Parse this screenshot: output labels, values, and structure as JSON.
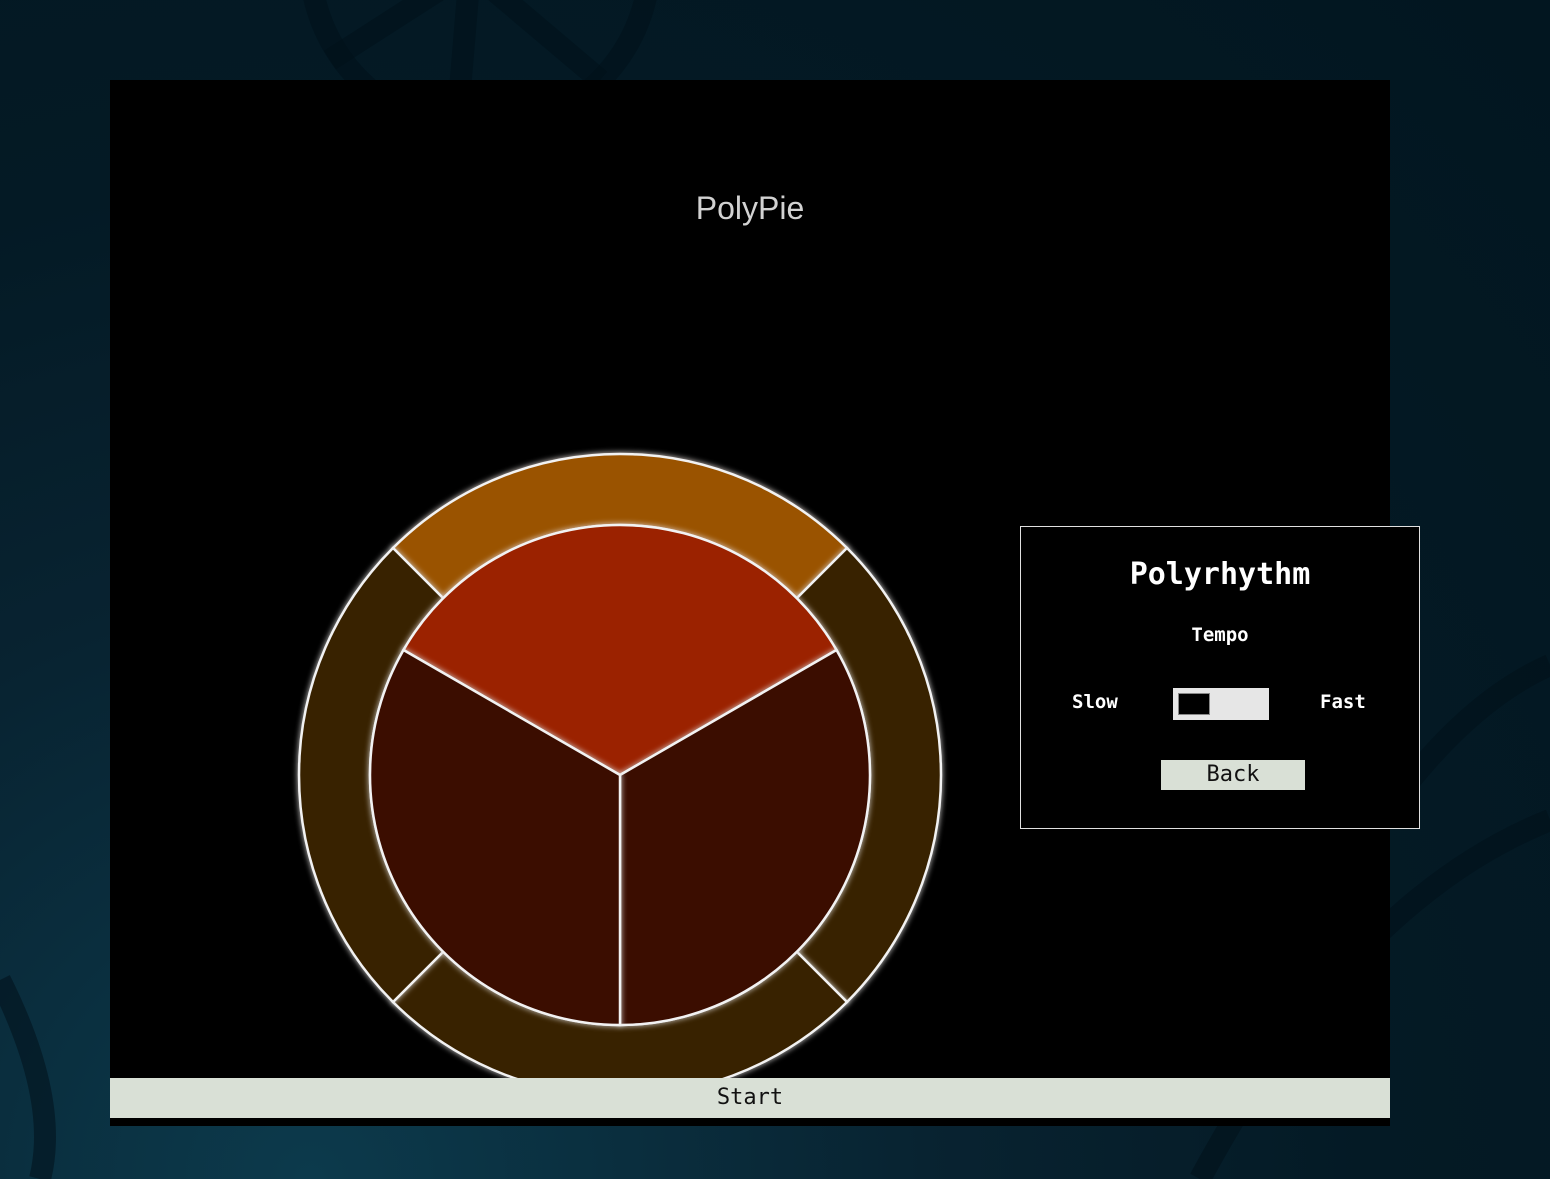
{
  "app": {
    "title": "PolyPie"
  },
  "pie": {
    "outer_ring": {
      "segments": 4,
      "active_index": 0,
      "active_color": "#9a5200",
      "inactive_color": "#372000"
    },
    "inner_pie": {
      "segments": 3,
      "active_index": 0,
      "active_color": "#9b2000",
      "inactive_color": "#3b0c00"
    },
    "outline_color": "#f2f2f2"
  },
  "panel": {
    "title": "Polyrhythm",
    "tempo_label": "Tempo",
    "slow_label": "Slow",
    "fast_label": "Fast",
    "tempo_value": 0,
    "back_label": "Back"
  },
  "footer": {
    "start_label": "Start"
  },
  "colors": {
    "frame_background": "#000000",
    "button_background": "#d9e0d6",
    "page_background": "#041a25"
  }
}
